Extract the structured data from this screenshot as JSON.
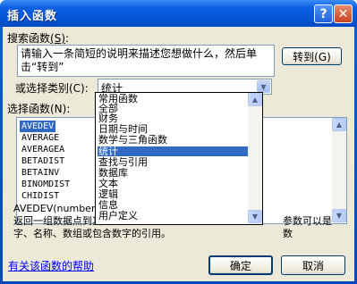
{
  "window": {
    "title": "插入函数"
  },
  "search": {
    "label_prefix": "搜索函数",
    "label_accel": "(S)",
    "label_suffix": ":",
    "text": "请输入一条简短的说明来描述您想做什么，然后单击“转到”",
    "go_label": "转到(G)"
  },
  "category": {
    "label": "或选择类别(C):",
    "selected": "统计",
    "options": [
      "常用函数",
      "全部",
      "财务",
      "日期与时间",
      "数学与三角函数",
      "统计",
      "查找与引用",
      "数据库",
      "文本",
      "逻辑",
      "信息",
      "用户定义"
    ],
    "highlighted_index": 5
  },
  "functions": {
    "label": "选择函数(N):",
    "items": [
      "AVEDEV",
      "AVERAGE",
      "AVERAGEA",
      "BETADIST",
      "BETAINV",
      "BINOMDIST",
      "CHIDIST"
    ],
    "selected_index": 0
  },
  "description": {
    "signature": "AVEDEV(number1,",
    "text_line1": "返回一组数据点到其",
    "text_line1_right": "参数可以是数",
    "text_line2": "字、名称、数组或包含数字的引用。"
  },
  "footer": {
    "help_link": "有关该函数的帮助",
    "ok_label": "确定",
    "cancel_label": "取消"
  },
  "icons": {
    "help": "?",
    "close": "✕",
    "dropdown_arrow": "▼",
    "scroll_up": "▲",
    "scroll_down": "▼"
  }
}
